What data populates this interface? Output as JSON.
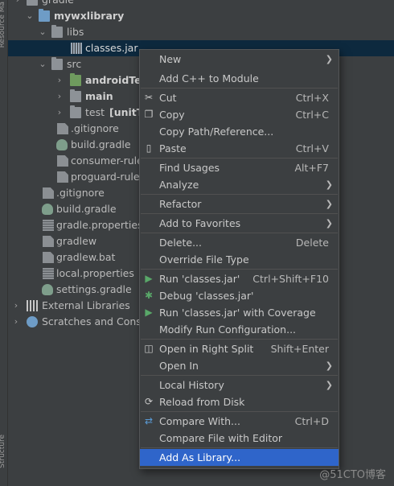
{
  "side_panel": {
    "top_label": "Resource Ma",
    "bottom_label": "Structure"
  },
  "tree": {
    "gradle": "gradle",
    "mywxlibrary": "mywxlibrary",
    "libs": "libs",
    "classes_jar": "classes.jar",
    "src": "src",
    "androidTest": "androidTes",
    "main": "main",
    "test_prefix": "test",
    "test_suffix": "[unitTe",
    "gitignore_inner": ".gitignore",
    "build_gradle_inner": "build.gradle",
    "consumer_rules": "consumer-rule",
    "proguard_rules": "proguard-rules",
    "gitignore": ".gitignore",
    "build_gradle": "build.gradle",
    "gradle_properties": "gradle.properties",
    "gradlew": "gradlew",
    "gradlew_bat": "gradlew.bat",
    "local_properties": "local.properties",
    "settings_gradle": "settings.gradle",
    "external_libraries": "External Libraries",
    "scratches": "Scratches and Conso"
  },
  "context_menu": {
    "new": "New",
    "add_cpp": "Add C++ to Module",
    "cut": "Cut",
    "cut_key": "Ctrl+X",
    "copy": "Copy",
    "copy_key": "Ctrl+C",
    "copy_path": "Copy Path/Reference...",
    "paste": "Paste",
    "paste_key": "Ctrl+V",
    "find_usages": "Find Usages",
    "find_usages_key": "Alt+F7",
    "analyze": "Analyze",
    "refactor": "Refactor",
    "add_favorites": "Add to Favorites",
    "delete": "Delete...",
    "delete_key": "Delete",
    "override_type": "Override File Type",
    "run": "Run 'classes.jar'",
    "run_key": "Ctrl+Shift+F10",
    "debug": "Debug 'classes.jar'",
    "run_coverage": "Run 'classes.jar' with Coverage",
    "modify_run": "Modify Run Configuration...",
    "open_split": "Open in Right Split",
    "open_split_key": "Shift+Enter",
    "open_in": "Open In",
    "local_history": "Local History",
    "reload": "Reload from Disk",
    "compare_with": "Compare With...",
    "compare_key": "Ctrl+D",
    "compare_editor": "Compare File with Editor",
    "add_library": "Add As Library..."
  },
  "watermark": "@51CTO博客",
  "colors": {
    "background": "#3c3f41",
    "selection": "#0d293e",
    "highlight": "#2f65ca"
  }
}
